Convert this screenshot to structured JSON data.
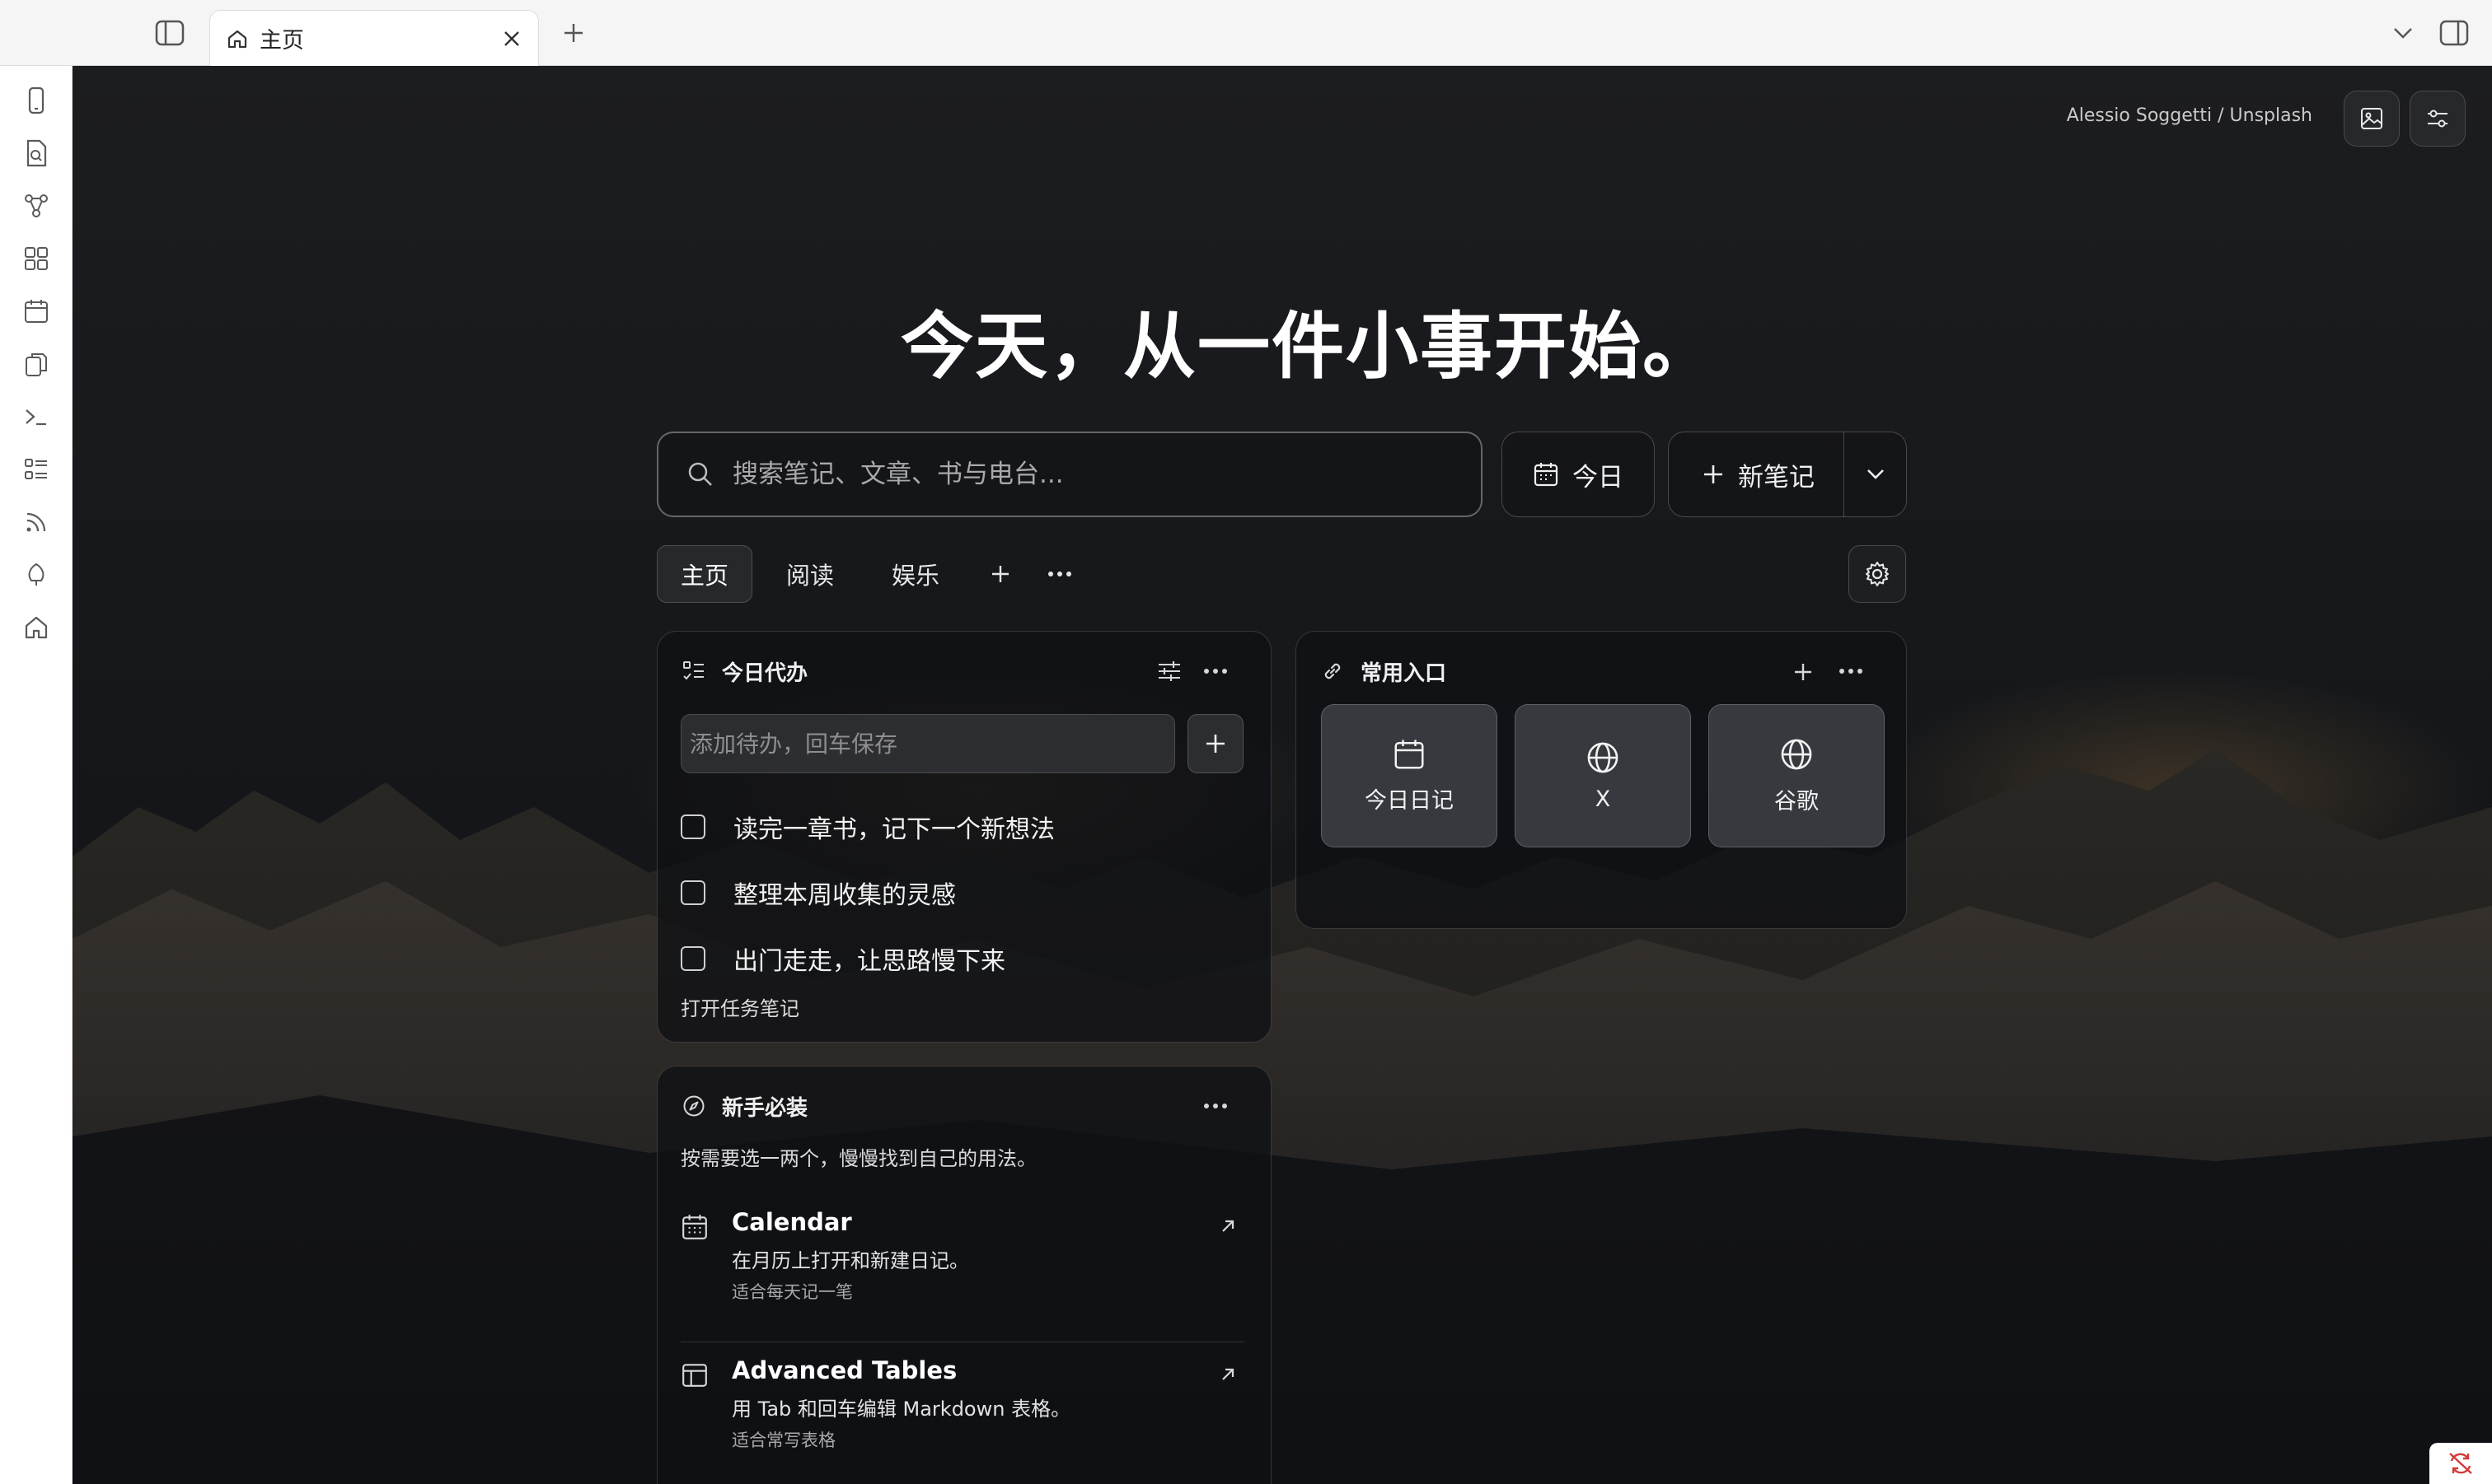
{
  "tabbar": {
    "tab_title": "主页"
  },
  "ribbon": {
    "icons": [
      "phone-icon",
      "file-search-icon",
      "graph-icon",
      "grid-icon",
      "calendar-icon",
      "files-icon",
      "terminal-icon",
      "list-icon",
      "rss-icon",
      "leaf-icon",
      "home-icon"
    ]
  },
  "background": {
    "credit": "Alessio Soggetti / Unsplash"
  },
  "hero": {
    "title": "今天，从一件小事开始。"
  },
  "search": {
    "placeholder": "搜索笔记、文章、书与电台..."
  },
  "actions": {
    "today_label": "今日",
    "new_note_label": "新笔记"
  },
  "nav_tabs": [
    {
      "label": "主页",
      "active": true
    },
    {
      "label": "阅读",
      "active": false
    },
    {
      "label": "娱乐",
      "active": false
    }
  ],
  "todo": {
    "title": "今日代办",
    "input_placeholder": "添加待办，回车保存",
    "items": [
      {
        "text": "读完一章书，记下一个新想法",
        "done": false
      },
      {
        "text": "整理本周收集的灵感",
        "done": false
      },
      {
        "text": "出门走走，让思路慢下来",
        "done": false
      }
    ],
    "open_link": "打开任务笔记"
  },
  "shortcuts": {
    "title": "常用入口",
    "tiles": [
      {
        "label": "今日日记",
        "icon": "calendar-icon"
      },
      {
        "label": "X",
        "icon": "globe-icon"
      },
      {
        "label": "谷歌",
        "icon": "globe-icon"
      }
    ]
  },
  "guide": {
    "title": "新手必装",
    "subtitle": "按需要选一两个，慢慢找到自己的用法。",
    "items": [
      {
        "name": "Calendar",
        "desc": "在月历上打开和新建日记。",
        "note": "适合每天记一笔",
        "icon": "calendar-icon"
      },
      {
        "name": "Advanced Tables",
        "desc": "用 Tab 和回车编辑 Markdown 表格。",
        "note": "适合常写表格",
        "icon": "table-icon"
      }
    ]
  },
  "colors": {
    "background_dark": "#16181b",
    "card_bg": "#111215",
    "tile_bg": "#404248",
    "badge_red": "#d23a3a"
  }
}
